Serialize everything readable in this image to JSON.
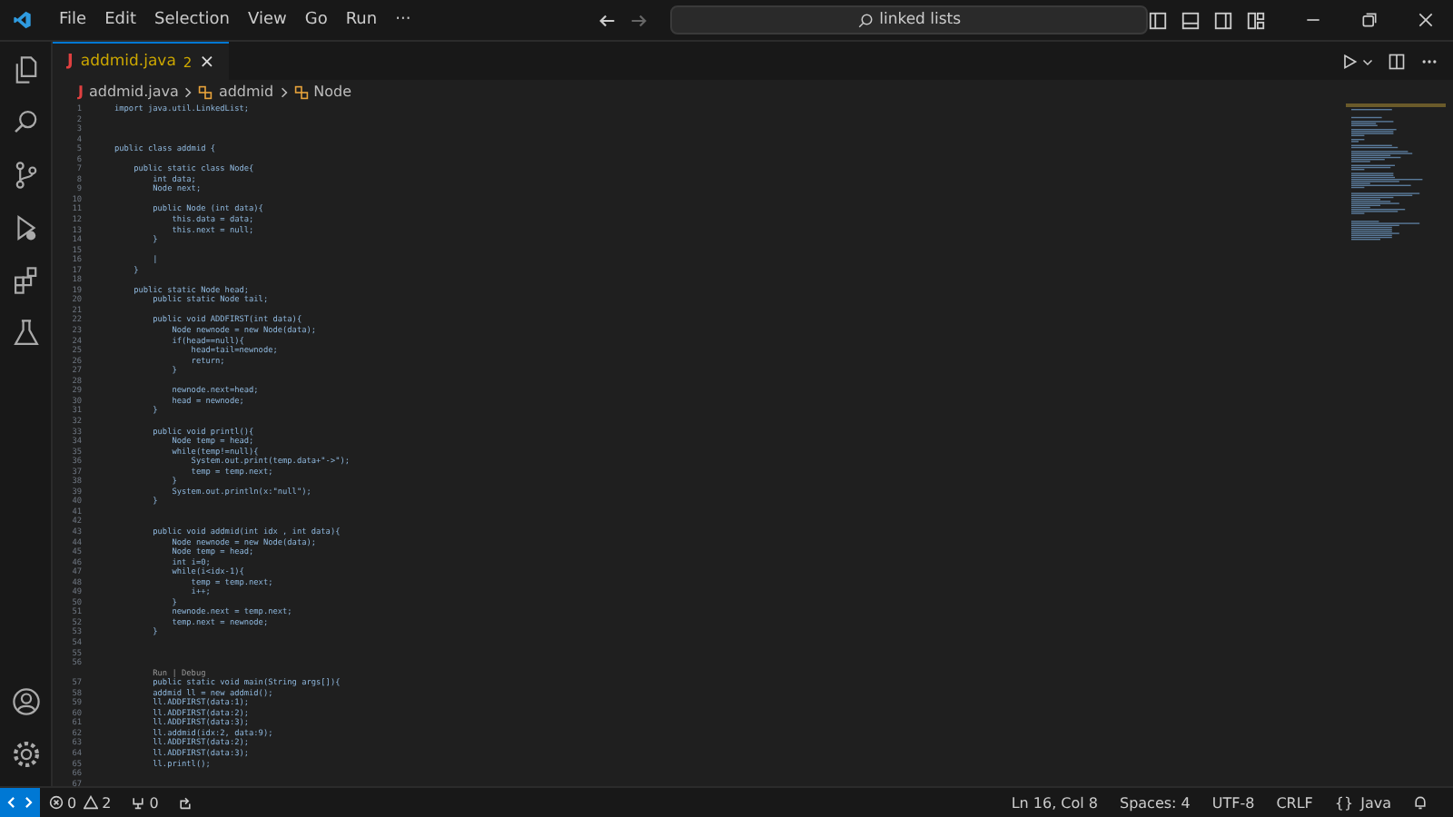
{
  "menu": [
    "File",
    "Edit",
    "Selection",
    "View",
    "Go",
    "Run",
    "···"
  ],
  "search": {
    "value": "linked lists"
  },
  "tab": {
    "icon": "J",
    "label": "addmid.java",
    "problems": "2",
    "close": "×"
  },
  "breadcrumb": [
    {
      "kind": "file",
      "icon": "J",
      "label": "addmid.java"
    },
    {
      "kind": "class",
      "label": "addmid"
    },
    {
      "kind": "class",
      "label": "Node"
    }
  ],
  "code": [
    {
      "kind": "line",
      "n": "1",
      "text": "import java.util.LinkedList;"
    },
    {
      "kind": "blank",
      "n": "2"
    },
    {
      "kind": "blank",
      "n": "3"
    },
    {
      "kind": "blank",
      "n": "4"
    },
    {
      "kind": "line",
      "n": "5",
      "text": "public class addmid {"
    },
    {
      "kind": "blank",
      "n": "6"
    },
    {
      "kind": "line",
      "n": "7",
      "text": "    public static class Node{"
    },
    {
      "kind": "line",
      "n": "8",
      "text": "        int data;"
    },
    {
      "kind": "line",
      "n": "9",
      "text": "        Node next;"
    },
    {
      "kind": "blank",
      "n": "10"
    },
    {
      "kind": "line",
      "n": "11",
      "text": "        public Node (int data){"
    },
    {
      "kind": "line",
      "n": "12",
      "text": "            this.data = data;"
    },
    {
      "kind": "line",
      "n": "13",
      "text": "            this.next = null;"
    },
    {
      "kind": "line",
      "n": "14",
      "text": "        }"
    },
    {
      "kind": "blank",
      "n": "15"
    },
    {
      "kind": "line",
      "n": "16",
      "text": "        |"
    },
    {
      "kind": "line",
      "n": "17",
      "text": "    }"
    },
    {
      "kind": "blank",
      "n": "18"
    },
    {
      "kind": "line",
      "n": "19",
      "text": "    public static Node head;"
    },
    {
      "kind": "line",
      "n": "20",
      "text": "        public static Node tail;"
    },
    {
      "kind": "blank",
      "n": "21"
    },
    {
      "kind": "line",
      "n": "22",
      "text": "        public void ADDFIRST(int data){"
    },
    {
      "kind": "line",
      "n": "23",
      "text": "            Node newnode = new Node(data);"
    },
    {
      "kind": "line",
      "n": "24",
      "text": "            if(head==null){"
    },
    {
      "kind": "line",
      "n": "25",
      "text": "                head=tail=newnode;"
    },
    {
      "kind": "line",
      "n": "26",
      "text": "                return;"
    },
    {
      "kind": "line",
      "n": "27",
      "text": "            }"
    },
    {
      "kind": "blank",
      "n": "28"
    },
    {
      "kind": "line",
      "n": "29",
      "text": "            newnode.next=head;"
    },
    {
      "kind": "line",
      "n": "30",
      "text": "            head = newnode;"
    },
    {
      "kind": "line",
      "n": "31",
      "text": "        }"
    },
    {
      "kind": "blank",
      "n": "32"
    },
    {
      "kind": "line",
      "n": "33",
      "text": "        public void printl(){"
    },
    {
      "kind": "line",
      "n": "34",
      "text": "            Node temp = head;"
    },
    {
      "kind": "line",
      "n": "35",
      "text": "            while(temp!=null){"
    },
    {
      "kind": "line",
      "n": "36",
      "text": "                System.out.print(temp.data+\"->\");"
    },
    {
      "kind": "line",
      "n": "37",
      "text": "                temp = temp.next;"
    },
    {
      "kind": "line",
      "n": "38",
      "text": "            }"
    },
    {
      "kind": "line",
      "n": "39",
      "text": "            System.out.println(x:\"null\");"
    },
    {
      "kind": "line",
      "n": "40",
      "text": "        }"
    },
    {
      "kind": "blank",
      "n": "41"
    },
    {
      "kind": "blank",
      "n": "42"
    },
    {
      "kind": "line",
      "n": "43",
      "text": "        public void addmid(int idx , int data){"
    },
    {
      "kind": "line",
      "n": "44",
      "text": "            Node newnode = new Node(data);"
    },
    {
      "kind": "line",
      "n": "45",
      "text": "            Node temp = head;"
    },
    {
      "kind": "line",
      "n": "46",
      "text": "            int i=0;"
    },
    {
      "kind": "line",
      "n": "47",
      "text": "            while(i<idx-1){"
    },
    {
      "kind": "line",
      "n": "48",
      "text": "                temp = temp.next;"
    },
    {
      "kind": "line",
      "n": "49",
      "text": "                i++;"
    },
    {
      "kind": "line",
      "n": "50",
      "text": "            }"
    },
    {
      "kind": "line",
      "n": "51",
      "text": "            newnode.next = temp.next;"
    },
    {
      "kind": "line",
      "n": "52",
      "text": "            temp.next = newnode;"
    },
    {
      "kind": "line",
      "n": "53",
      "text": "        }"
    },
    {
      "kind": "blank",
      "n": "54"
    },
    {
      "kind": "blank",
      "n": "55"
    },
    {
      "kind": "blank",
      "n": "56"
    },
    {
      "kind": "codelens",
      "text": "        Run | Debug"
    },
    {
      "kind": "line",
      "n": "57",
      "text": "        public static void main(String args[]){"
    },
    {
      "kind": "line",
      "n": "58",
      "text": "        addmid ll = new addmid();"
    },
    {
      "kind": "line",
      "n": "59",
      "text": "        ll.ADDFIRST(data:1);"
    },
    {
      "kind": "line",
      "n": "60",
      "text": "        ll.ADDFIRST(data:2);"
    },
    {
      "kind": "line",
      "n": "61",
      "text": "        ll.ADDFIRST(data:3);"
    },
    {
      "kind": "line",
      "n": "62",
      "text": "        ll.addmid(idx:2, data:9);"
    },
    {
      "kind": "line",
      "n": "63",
      "text": "        ll.ADDFIRST(data:2);"
    },
    {
      "kind": "line",
      "n": "64",
      "text": "        ll.ADDFIRST(data:3);"
    },
    {
      "kind": "line",
      "n": "65",
      "text": "        ll.printl();"
    },
    {
      "kind": "blank",
      "n": "66"
    },
    {
      "kind": "blank",
      "n": "67"
    }
  ],
  "status": {
    "errors": "0",
    "warnings": "2",
    "ports": "0",
    "position": "Ln 16, Col 8",
    "spaces": "Spaces: 4",
    "encoding": "UTF-8",
    "eol": "CRLF",
    "language_icon": "{}",
    "language": "Java"
  }
}
